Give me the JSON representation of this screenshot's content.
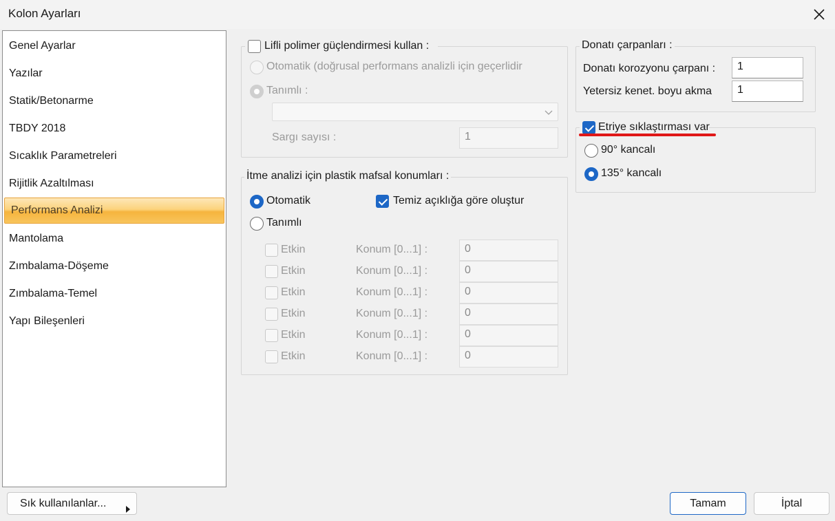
{
  "window": {
    "title": "Kolon Ayarları"
  },
  "sidebar": {
    "items": [
      {
        "label": "Genel Ayarlar"
      },
      {
        "label": "Yazılar"
      },
      {
        "label": "Statik/Betonarme"
      },
      {
        "label": "TBDY 2018"
      },
      {
        "label": "Sıcaklık Parametreleri"
      },
      {
        "label": "Rijitlik Azaltılması"
      },
      {
        "label": "Performans Analizi",
        "selected": true
      },
      {
        "label": "Mantolama"
      },
      {
        "label": "Zımbalama-Döşeme"
      },
      {
        "label": "Zımbalama-Temel"
      },
      {
        "label": "Yapı Bileşenleri"
      }
    ]
  },
  "frp": {
    "checkbox_label": "Lifli polimer güçlendirmesi kullan :",
    "checked": false,
    "auto_label": "Otomatik (doğrusal performans analizli için geçerlidir",
    "defined_label": "Tanımlı :",
    "combo_value": "",
    "layers_label": "Sargı sayısı :",
    "layers_value": "1"
  },
  "hinge": {
    "legend": "İtme analizi için plastik mafsal konumları :",
    "auto_label": "Otomatik",
    "defined_label": "Tanımlı",
    "clear_span_label": "Temiz açıklığa göre oluştur",
    "clear_span_checked": true,
    "rows": [
      {
        "active_label": "Etkin",
        "position_label": "Konum [0...1] :",
        "value": "0"
      },
      {
        "active_label": "Etkin",
        "position_label": "Konum [0...1] :",
        "value": "0"
      },
      {
        "active_label": "Etkin",
        "position_label": "Konum [0...1] :",
        "value": "0"
      },
      {
        "active_label": "Etkin",
        "position_label": "Konum [0...1] :",
        "value": "0"
      },
      {
        "active_label": "Etkin",
        "position_label": "Konum [0...1] :",
        "value": "0"
      },
      {
        "active_label": "Etkin",
        "position_label": "Konum [0...1] :",
        "value": "0"
      }
    ]
  },
  "rebar_factors": {
    "legend": "Donatı çarpanları :",
    "corrosion_label": "Donatı korozyonu çarpanı :",
    "corrosion_value": "1",
    "anchorage_label": "Yetersiz kenet. boyu akma",
    "anchorage_value": "1"
  },
  "stirrup": {
    "checkbox_label": "Etriye sıklaştırması var",
    "checked": true,
    "hook90_label": "90° kancalı",
    "hook135_label": "135° kancalı",
    "selected": "135",
    "highlight_color": "#e01818"
  },
  "footer": {
    "favorites_label": "Sık kullanılanlar...",
    "ok_label": "Tamam",
    "cancel_label": "İptal"
  },
  "colors": {
    "accent": "#1d67c6",
    "selection": "#f6b43e"
  }
}
